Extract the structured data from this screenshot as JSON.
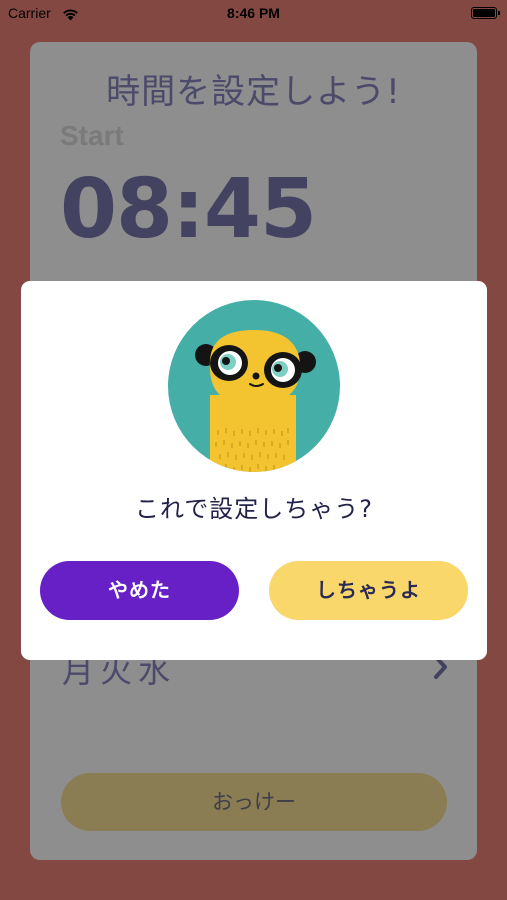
{
  "status_bar": {
    "carrier": "Carrier",
    "time": "8:46 PM"
  },
  "card": {
    "title": "時間を設定しよう!",
    "start_label": "Start",
    "start_time": "08:45",
    "days": "月火水",
    "ok_label": "おっけー"
  },
  "dialog": {
    "message": "これで設定しちゃう?",
    "cancel_label": "やめた",
    "confirm_label": "しちゃうよ"
  },
  "colors": {
    "backdrop": "#844842",
    "cancel_button": "#6620c6",
    "confirm_button": "#fad76a",
    "avatar_background": "#45aea6",
    "meerkat": "#f4c430"
  }
}
